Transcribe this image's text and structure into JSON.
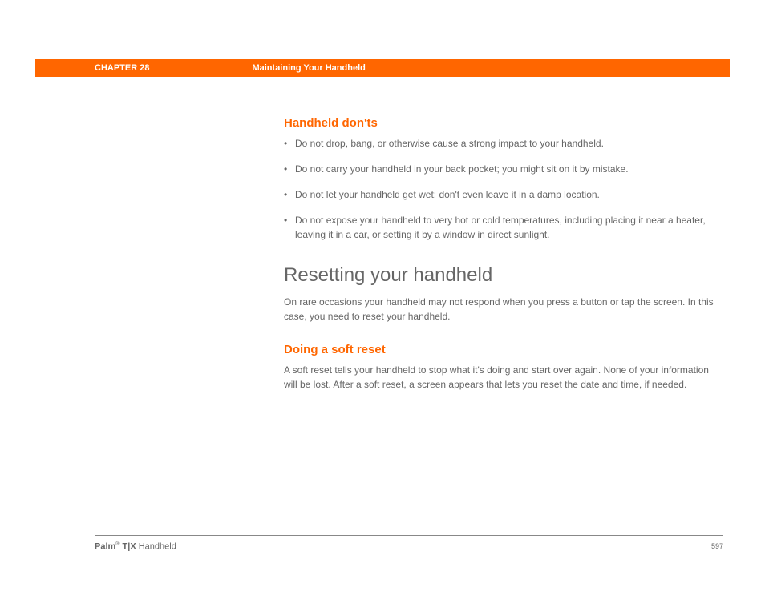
{
  "header": {
    "chapter": "CHAPTER 28",
    "title": "Maintaining Your Handheld"
  },
  "sections": {
    "donts": {
      "heading": "Handheld don'ts",
      "bullets": [
        "Do not drop, bang, or otherwise cause a strong impact to your handheld.",
        "Do not carry your handheld in your back pocket; you might sit on it by mistake.",
        "Do not let your handheld get wet; don't even leave it in a damp location.",
        "Do not expose your handheld to very hot or cold temperatures, including placing it near a heater, leaving it in a car, or setting it by a window in direct sunlight."
      ]
    },
    "resetting": {
      "heading": "Resetting your handheld",
      "intro": "On rare occasions your handheld may not respond when you press a button or tap the screen. In this case, you need to reset your handheld."
    },
    "softreset": {
      "heading": "Doing a soft reset",
      "text": "A soft reset tells your handheld to stop what it's doing and start over again. None of your information will be lost. After a soft reset, a screen appears that lets you reset the date and time, if needed."
    }
  },
  "footer": {
    "brand_bold": "Palm",
    "brand_reg": "®",
    "brand_model": " T|X",
    "brand_suffix": " Handheld",
    "page": "597"
  }
}
